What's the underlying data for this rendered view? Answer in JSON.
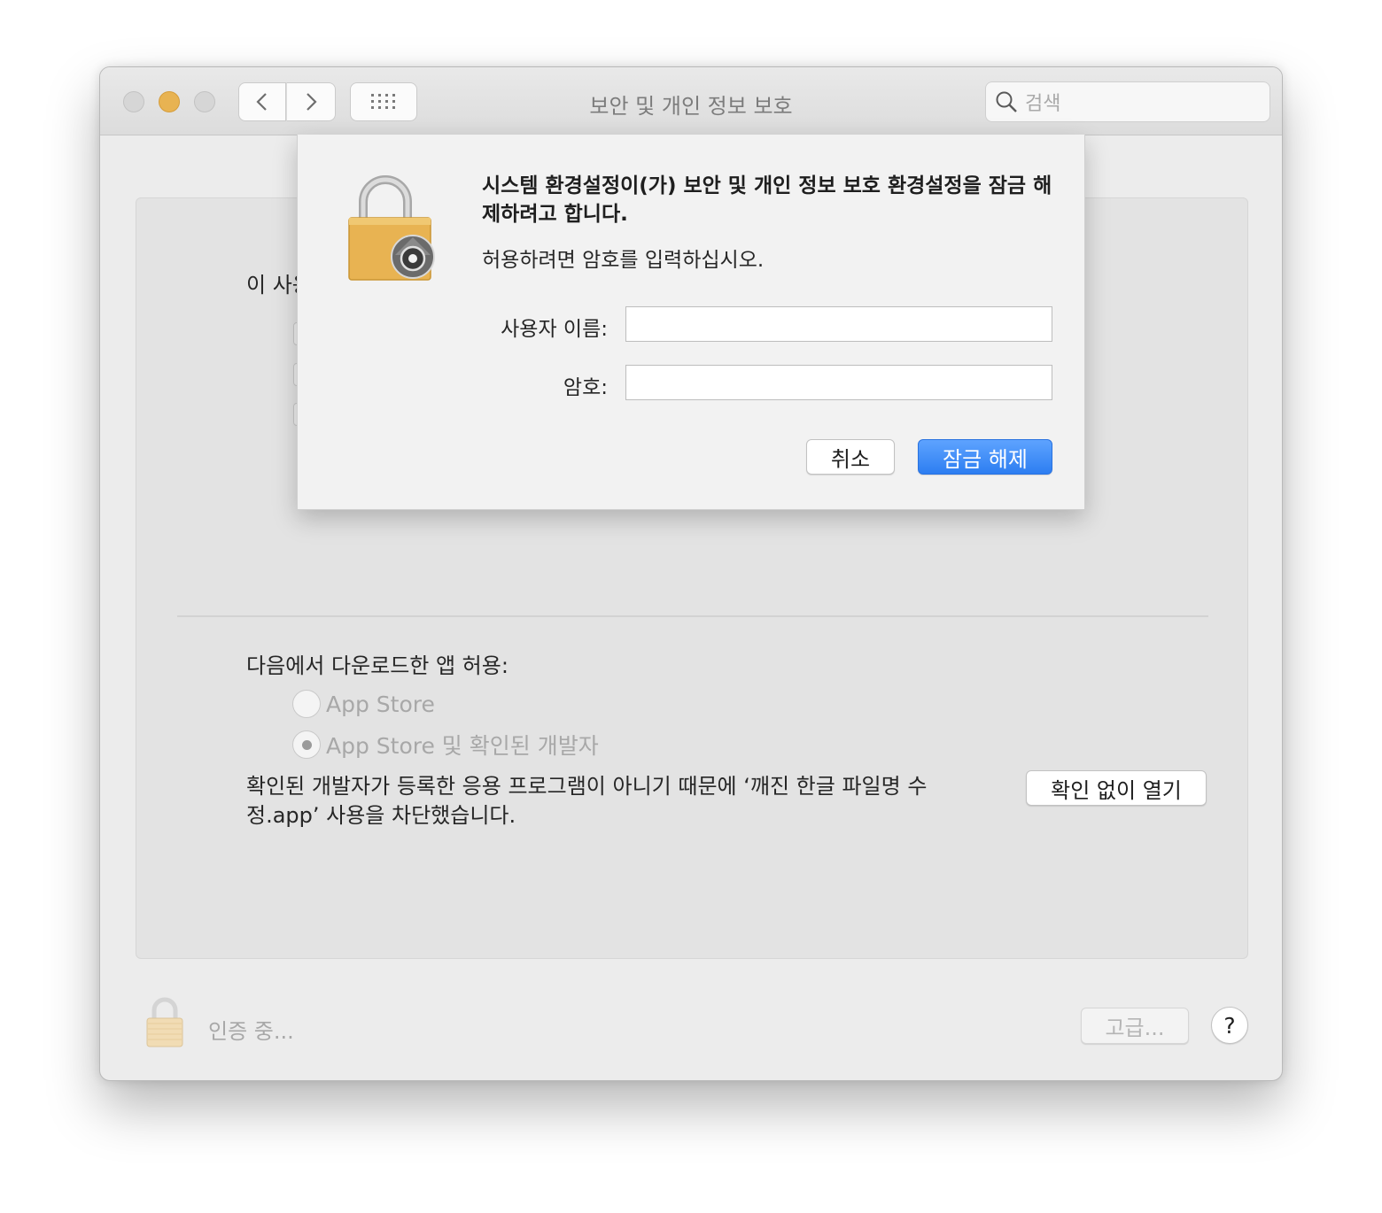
{
  "window": {
    "title": "보안 및 개인 정보 보호",
    "search_placeholder": "검색"
  },
  "background_panel": {
    "partial_text": "이 사용",
    "allow_label": "다음에서 다운로드한 앱 허용:",
    "radio_options": [
      {
        "label": "App Store",
        "selected": false
      },
      {
        "label": "App Store 및 확인된 개발자",
        "selected": true
      }
    ],
    "blocked_message": "확인된 개발자가 등록한 응용 프로그램이 아니기 때문에 ‘깨진 한글 파일명 수정.app’ 사용을 차단했습니다.",
    "open_anyway_label": "확인 없이 열기"
  },
  "footer": {
    "status_text": "인증 중...",
    "advanced_label": "고급...",
    "help_label": "?"
  },
  "auth_sheet": {
    "title": "시스템 환경설정이(가) 보안 및 개인 정보 보호 환경설정을 잠금 해제하려고 합니다.",
    "message": "허용하려면 암호를 입력하십시오.",
    "username_label": "사용자 이름:",
    "password_label": "암호:",
    "username_value": "",
    "password_value": "",
    "cancel_label": "취소",
    "unlock_label": "잠금 해제"
  },
  "icons": {
    "lock": "lock-icon",
    "search": "search-icon",
    "back": "chevron-left-icon",
    "forward": "chevron-right-icon",
    "grid": "grid-icon"
  },
  "colors": {
    "accent": "#2d7ef1",
    "minimize": "#e8b352",
    "lock_body": "#e8b352"
  }
}
